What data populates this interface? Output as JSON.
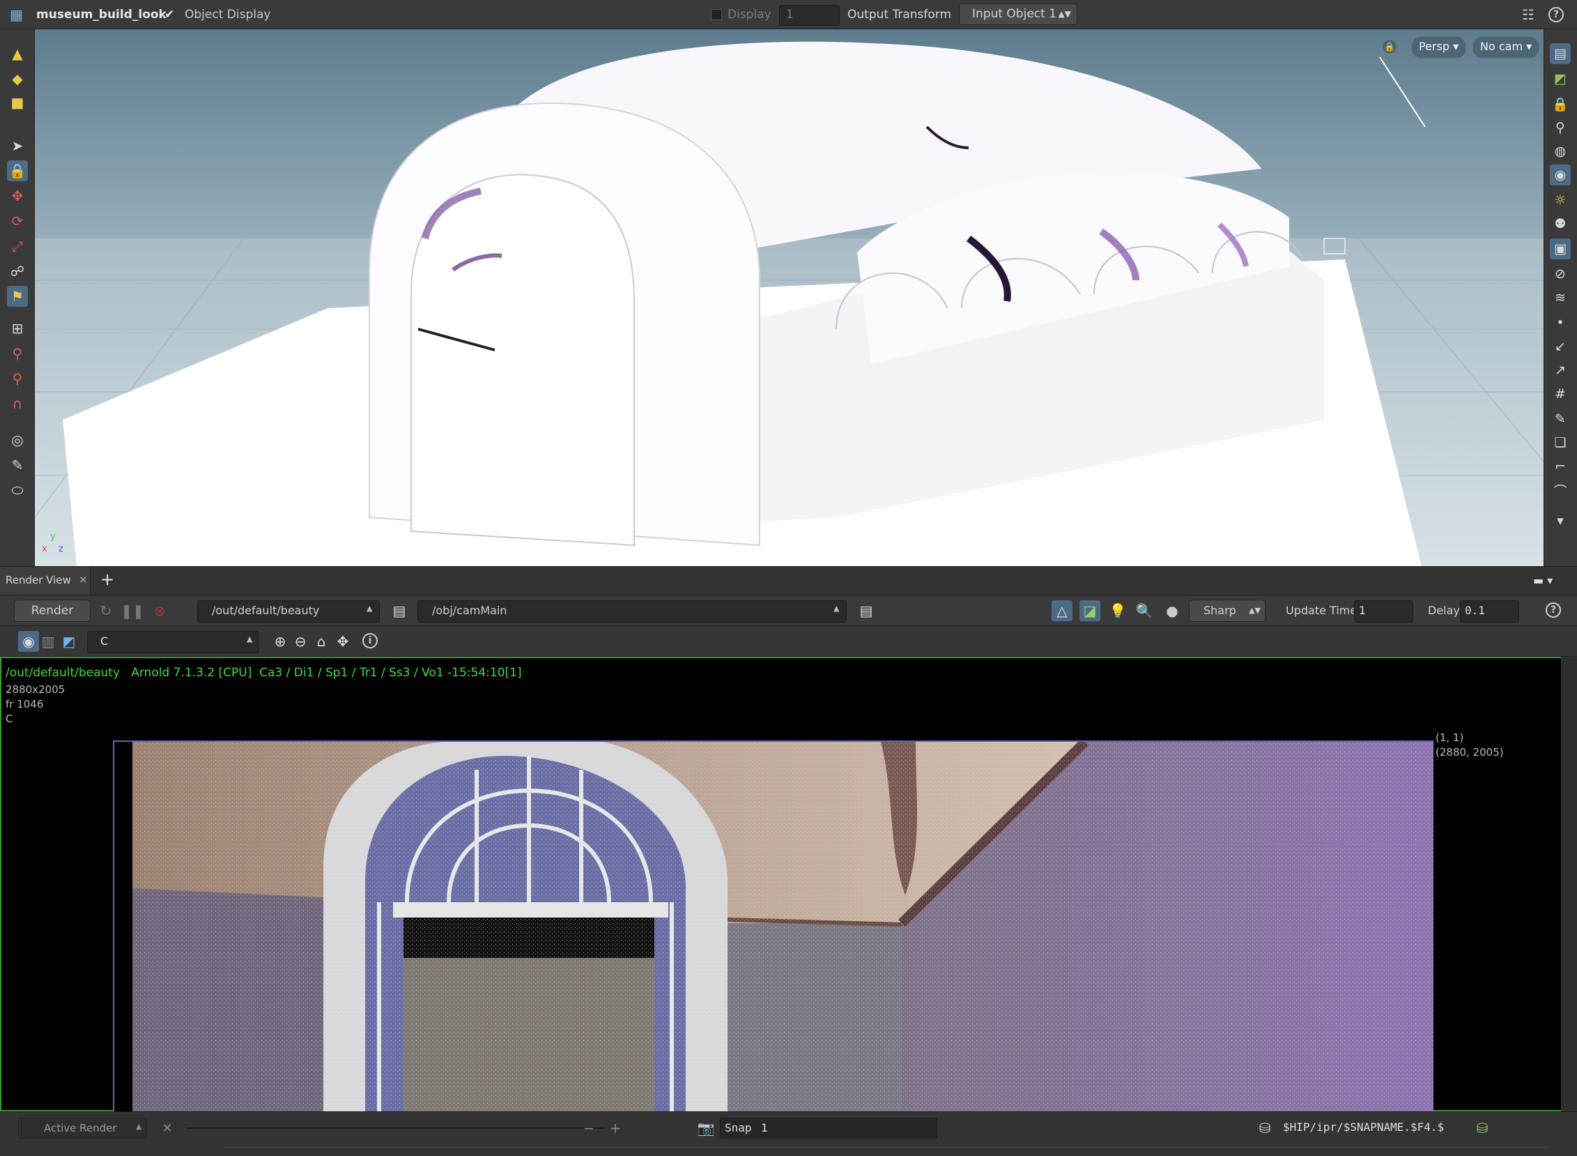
{
  "topbar": {
    "scene_name": "museum_build_look",
    "object_display_label": "Object Display",
    "display_label": "Display",
    "display_value": "1",
    "output_transform_label": "Output Transform",
    "input_object_value": "Input Object 1",
    "help_glyph": "?"
  },
  "viewport": {
    "persp_label": "Persp ▾",
    "cam_label": "No cam ▾",
    "axes": {
      "x": "x",
      "y": "y",
      "z": "z"
    }
  },
  "pane_tabs": {
    "render_view_tab": "Render View",
    "close_glyph": "×",
    "add_glyph": "+"
  },
  "render_toolbar": {
    "render_button": "Render",
    "rop_path": "/out/default/beauty",
    "camera_path": "/obj/camMain",
    "sharp_label": "Sharp",
    "update_time_label": "Update Time",
    "update_time_value": "1",
    "delay_label": "Delay",
    "delay_value": "0.1",
    "help_glyph": "?"
  },
  "render_toolbar2": {
    "aov_value": "C",
    "info_glyph": "i"
  },
  "render_info": {
    "header": "/out/default/beauty   Arnold 7.1.3.2 [CPU]  Ca3 / Di1 / Sp1 / Tr1 / Ss3 / Vo1 -15:54:10[1]",
    "resolution": "2880x2005",
    "frame": "fr 1046",
    "channel": "C",
    "corner_top": "(1, 1)",
    "corner_bottom": "(2880, 2005)"
  },
  "statusbar": {
    "active_render_label": "Active Render",
    "snap_label": "Snap",
    "snap_value": "1",
    "snapshot_path": "$HIP/ipr/$SNAPNAME.$F4.$",
    "minus_glyph": "−",
    "plus_glyph": "+"
  },
  "colors": {
    "accent_green": "#3edc3e",
    "panel_bg": "#3a3a3a",
    "render_bg": "#000000"
  }
}
